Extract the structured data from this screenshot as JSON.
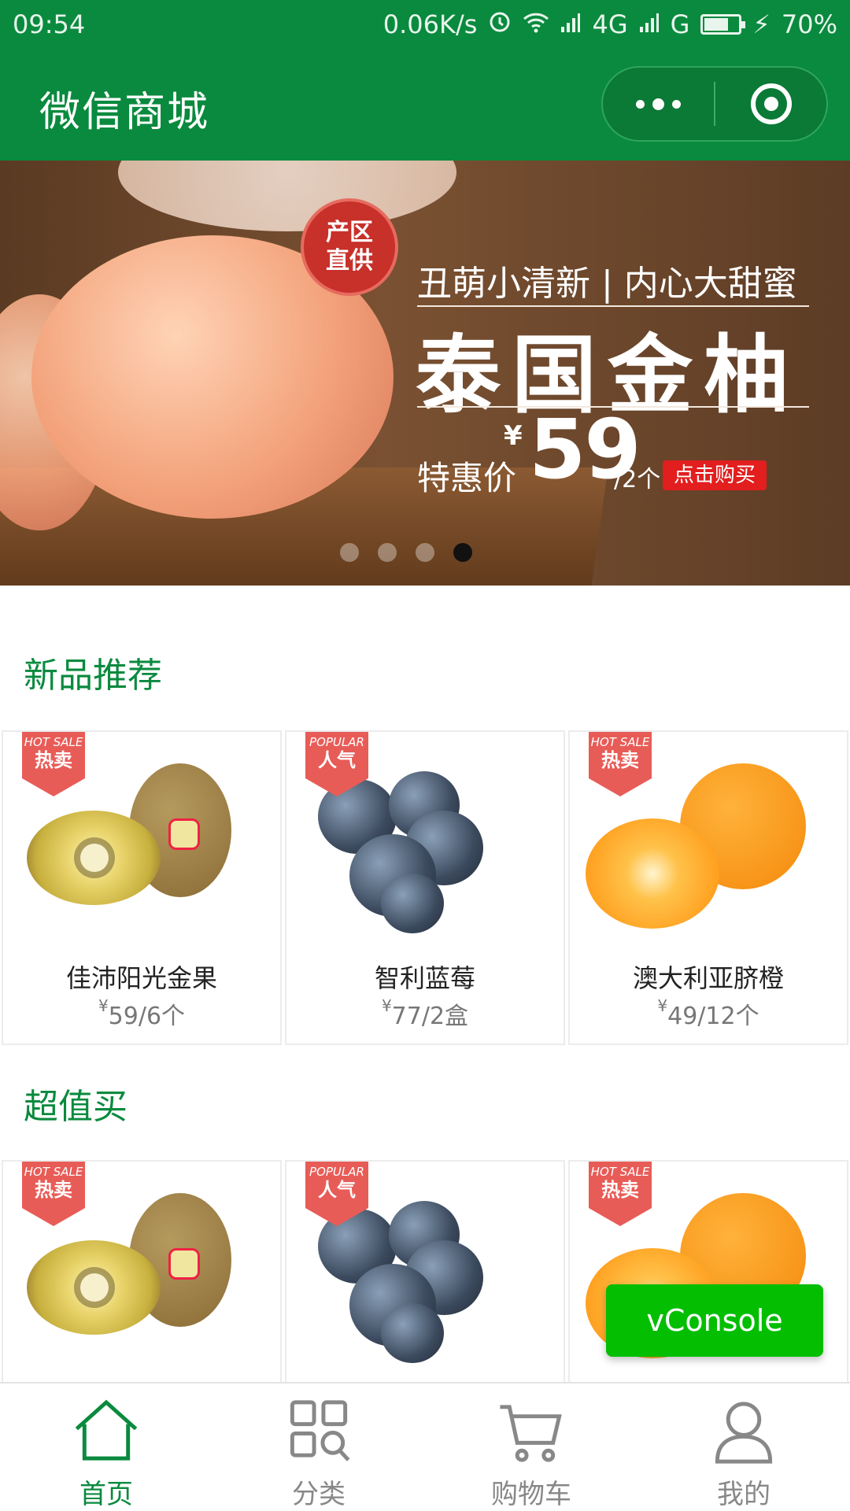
{
  "status_bar": {
    "time": "09:54",
    "net_speed": "0.06K/s",
    "network_1": "4G",
    "network_2": "G",
    "battery": "70%",
    "battery_level": 0.7
  },
  "nav": {
    "title": "微信商城"
  },
  "banner": {
    "seal_line1": "产区",
    "seal_line2": "直供",
    "subtitle": "丑萌小清新 | 内心大甜蜜",
    "title": "泰国金柚",
    "price_label": "特惠价",
    "currency": "¥",
    "price": "59",
    "unit": "/2个",
    "buy_label": "点击购买",
    "slide_count": 4,
    "active_slide": 4
  },
  "sections": [
    {
      "title": "新品推荐",
      "products": [
        {
          "tag_en": "HOT SALE",
          "tag_cn": "热卖",
          "name": "佳沛阳光金果",
          "currency": "¥",
          "price": "59/6个",
          "fruit": "kiwi"
        },
        {
          "tag_en": "POPULAR",
          "tag_cn": "人气",
          "name": "智利蓝莓",
          "currency": "¥",
          "price": "77/2盒",
          "fruit": "blueberry"
        },
        {
          "tag_en": "HOT SALE",
          "tag_cn": "热卖",
          "name": "澳大利亚脐橙",
          "currency": "¥",
          "price": "49/12个",
          "fruit": "orange"
        }
      ]
    },
    {
      "title": "超值买",
      "products": [
        {
          "tag_en": "HOT SALE",
          "tag_cn": "热卖",
          "fruit": "kiwi"
        },
        {
          "tag_en": "POPULAR",
          "tag_cn": "人气",
          "fruit": "blueberry"
        },
        {
          "tag_en": "HOT SALE",
          "tag_cn": "热卖",
          "fruit": "orange"
        }
      ]
    }
  ],
  "vconsole": {
    "label": "vConsole"
  },
  "tabs": [
    {
      "label": "首页",
      "icon": "home-icon",
      "active": true
    },
    {
      "label": "分类",
      "icon": "category-icon",
      "active": false
    },
    {
      "label": "购物车",
      "icon": "cart-icon",
      "active": false
    },
    {
      "label": "我的",
      "icon": "profile-icon",
      "active": false
    }
  ],
  "colors": {
    "brand_green": "#0a8a3e",
    "tag_red": "#e85c57",
    "vconsole_green": "#04be02"
  }
}
